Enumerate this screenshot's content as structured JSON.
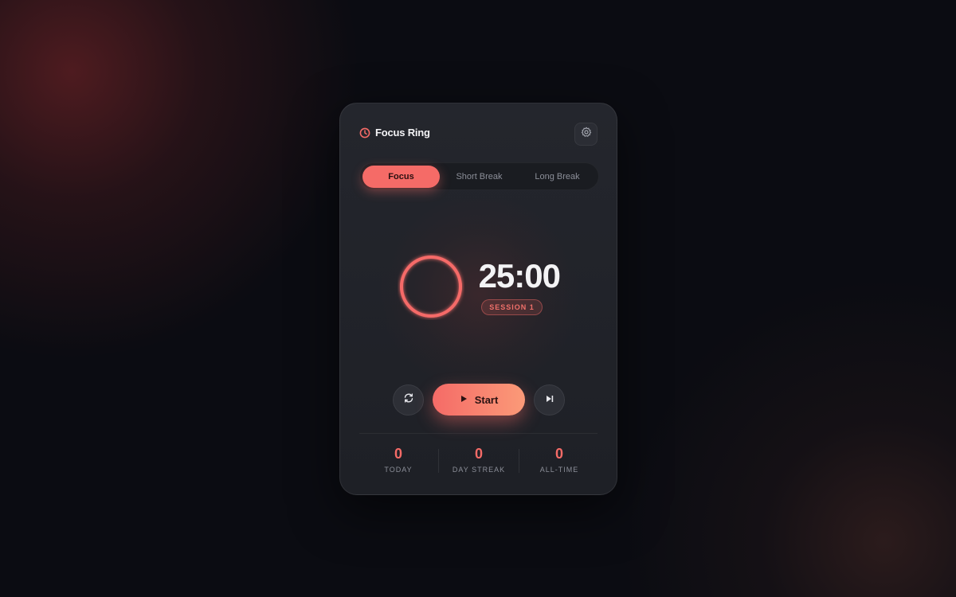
{
  "app": {
    "title": "Focus Ring"
  },
  "header": {
    "brand_icon": "clock-icon",
    "settings_icon": "gear-icon"
  },
  "tabs": [
    {
      "label": "Focus",
      "active": true
    },
    {
      "label": "Short Break",
      "active": false
    },
    {
      "label": "Long Break",
      "active": false
    }
  ],
  "timer": {
    "time": "25:00",
    "session_label": "SESSION 1",
    "progress": 1.0
  },
  "controls": {
    "reset_icon": "reset-icon",
    "start_label": "Start",
    "start_icon": "play-icon",
    "skip_icon": "skip-forward-icon"
  },
  "stats": [
    {
      "value": "0",
      "label": "TODAY"
    },
    {
      "value": "0",
      "label": "DAY STREAK"
    },
    {
      "value": "0",
      "label": "ALL-TIME"
    }
  ],
  "colors": {
    "accent": "#f56b67",
    "accent_end": "#fb9a78",
    "card_bg": "#24262d",
    "page_bg": "#0b0c12"
  }
}
